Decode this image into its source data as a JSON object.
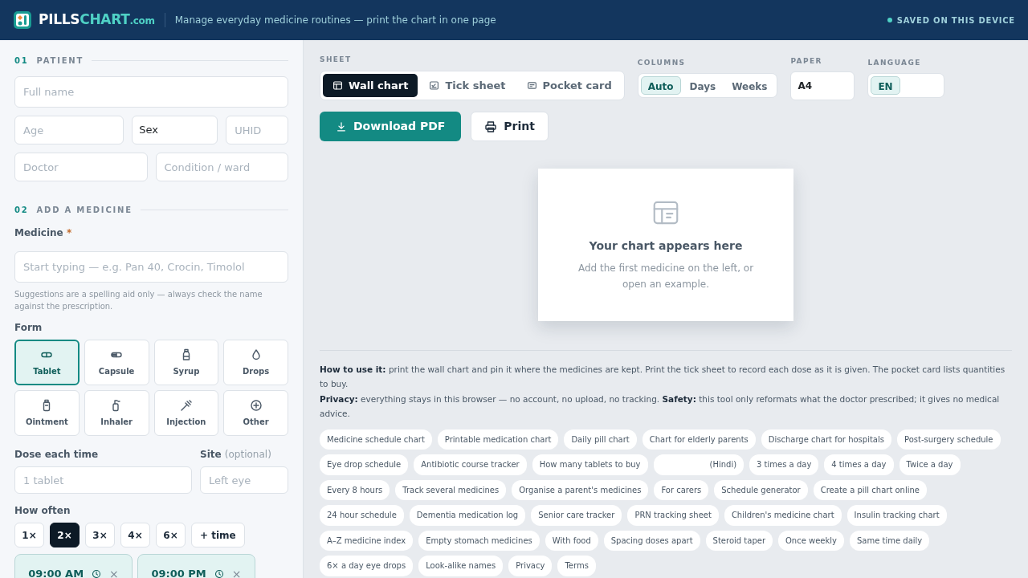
{
  "header": {
    "logo_main": "PILLS",
    "logo_accent": "CHART",
    "logo_suffix": ".com",
    "tagline": "Manage everyday medicine routines — print the chart in one page",
    "status": "SAVED ON THIS DEVICE"
  },
  "patient": {
    "number": "01",
    "title": "PATIENT",
    "fields": [
      {
        "kind": "input",
        "placeholder": "Full name"
      },
      {
        "kind": "input",
        "placeholder": "Age"
      },
      {
        "kind": "select",
        "value": "Sex"
      },
      {
        "kind": "input",
        "placeholder": "UHID"
      },
      {
        "kind": "input",
        "placeholder": "Doctor"
      },
      {
        "kind": "input",
        "placeholder": "Condition / ward"
      }
    ]
  },
  "medicine": {
    "number": "02",
    "title": "ADD A MEDICINE",
    "label": "Medicine",
    "required_mark": "*",
    "placeholder": "Start typing — e.g. Pan 40, Crocin, Timolol",
    "hint": "Suggestions are a spelling aid only — always check the name against the prescription.",
    "form": {
      "label": "Form",
      "options": [
        {
          "label": "Tablet",
          "selected": true
        },
        {
          "label": "Capsule",
          "selected": false
        },
        {
          "label": "Syrup",
          "selected": false
        },
        {
          "label": "Drops",
          "selected": false
        },
        {
          "label": "Ointment",
          "selected": false
        },
        {
          "label": "Inhaler",
          "selected": false
        },
        {
          "label": "Injection",
          "selected": false
        },
        {
          "label": "Other",
          "selected": false
        }
      ]
    },
    "dose": {
      "label": "Dose each time",
      "placeholder": "1 tablet"
    },
    "site": {
      "label": "Site",
      "note": "(optional)",
      "placeholder": "Left eye"
    },
    "how_often": {
      "label": "How often",
      "options": [
        {
          "label": "1×",
          "selected": false
        },
        {
          "label": "2×",
          "selected": true
        },
        {
          "label": "3×",
          "selected": false
        },
        {
          "label": "4×",
          "selected": false
        },
        {
          "label": "6×",
          "selected": false
        }
      ],
      "add_button": "+ time"
    },
    "times": [
      {
        "time": "09:00 AM",
        "remove": "×"
      },
      {
        "time": "09:00 PM",
        "remove": "×"
      }
    ]
  },
  "toolbar": {
    "sheet": {
      "label": "SHEET",
      "tabs": [
        {
          "label": "Wall chart",
          "selected": true
        },
        {
          "label": "Tick sheet",
          "selected": false
        },
        {
          "label": "Pocket card",
          "selected": false
        }
      ]
    },
    "columns": {
      "label": "COLUMNS",
      "options": [
        {
          "label": "Auto",
          "selected": true
        },
        {
          "label": "Days",
          "selected": false
        },
        {
          "label": "Weeks",
          "selected": false
        }
      ]
    },
    "paper": {
      "label": "PAPER",
      "value": "A4"
    },
    "language": {
      "label": "LANGUAGE",
      "options": [
        {
          "label": "EN",
          "selected": true
        }
      ]
    }
  },
  "actions": {
    "download": "Download PDF",
    "print": "Print"
  },
  "empty_state": {
    "title": "Your chart appears here",
    "text": "Add the first medicine on the left, or open an example."
  },
  "info": [
    "**How to use it:** print the wall chart and pin it where the medicines are kept. Print the tick sheet to record each dose as it is given. The pocket card lists quantities to buy.",
    "**Privacy:** everything stays in this browser — no account, no upload, no tracking. **Safety:** this tool only reformats what the doctor prescribed; it gives no medical advice."
  ],
  "links": [
    "Medicine schedule chart",
    "Printable medication chart",
    "Daily pill chart",
    "Chart for elderly parents",
    "Discharge chart for hospitals",
    "Post-surgery schedule",
    "Eye drop schedule",
    "Antibiotic course tracker",
    "How many tablets to buy",
    "(Hindi)",
    "3 times a day",
    "4 times a day",
    "Twice a day",
    "Every 8 hours",
    "Track several medicines",
    "Organise a parent's medicines",
    "For carers",
    "Schedule generator",
    "Create a pill chart online",
    "24 hour schedule",
    "Dementia medication log",
    "Senior care tracker",
    "PRN tracking sheet",
    "Children's medicine chart",
    "Insulin tracking chart",
    "A–Z medicine index",
    "Empty stomach medicines",
    "With food",
    "Spacing doses apart",
    "Steroid taper",
    "Once weekly",
    "Same time daily",
    "6× a day eye drops",
    "Look-alike names",
    "Privacy",
    "Terms"
  ]
}
